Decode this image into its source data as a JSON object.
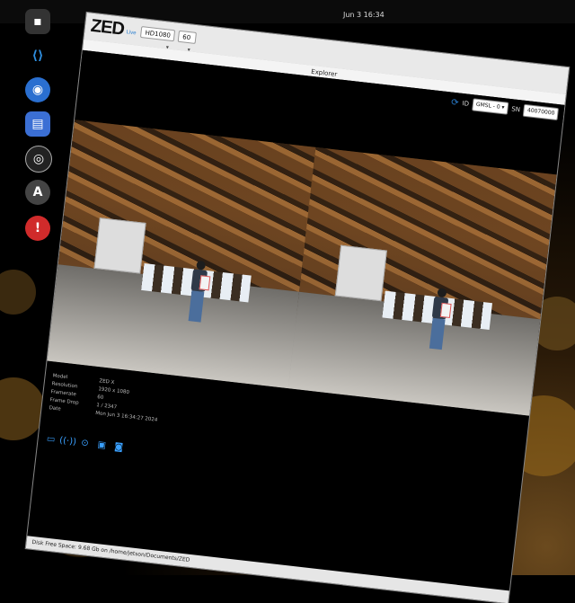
{
  "window": {
    "app_logo": "ZED",
    "app_logo_sub": "Live",
    "title": "Explorer",
    "resolution_select": "HD1080",
    "fps_select": "60"
  },
  "camera_select": {
    "label": "ID",
    "value": "GMSL - 0",
    "sn_label": "SN",
    "sn_value": "40070000"
  },
  "clock": "Jun 3 16:34",
  "info": [
    {
      "label": "Model",
      "value": "ZED X"
    },
    {
      "label": "Resolution",
      "value": "1920 x 1080"
    },
    {
      "label": "Framerate",
      "value": "60"
    },
    {
      "label": "Frame Drop",
      "value": "1 / 2347"
    },
    {
      "label": "Date",
      "value": "Mon Jun 3 16:34:27 2024"
    }
  ],
  "status_bar": "Disk Free Space: 9.68 Gb on /home/jetson/Documents/ZED",
  "toolbar": [
    "folder-icon",
    "stream-icon",
    "sd-card-icon",
    "info-icon",
    "camera-icon"
  ],
  "dock": [
    "terminal-icon",
    "vscode-icon",
    "chromium-icon",
    "files-icon",
    "obs-icon",
    "accessibility-icon",
    "update-icon"
  ],
  "colors": {
    "accent": "#2a7fd0",
    "titlebar": "#e9e9e9",
    "status_bar": "#e6e6e6"
  }
}
